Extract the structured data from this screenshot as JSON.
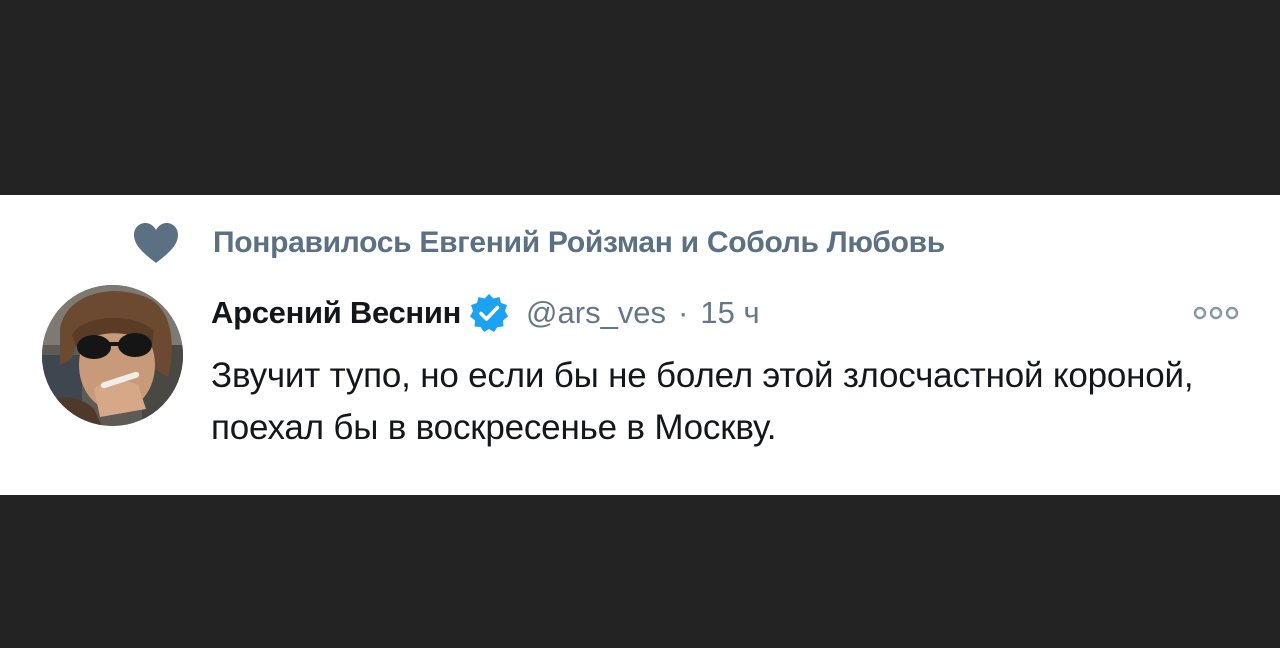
{
  "social_context": {
    "text": "Понравилось Евгений Ройзман и Соболь Любовь",
    "icon": "heart-icon"
  },
  "tweet": {
    "author_name": "Арсений Веснин",
    "verified_icon": "verified-badge-icon",
    "handle": "@ars_ves",
    "separator": "·",
    "time": "15 ч",
    "text": "Звучит тупо, но если бы не болел этой злосчастной короной, поехал бы в воскресенье в Москву.",
    "more_icon": "more-options-icon"
  },
  "colors": {
    "background": "#232323",
    "card": "#ffffff",
    "secondary_text": "#5b7083",
    "primary_text": "#14171a",
    "verified": "#1da1f2"
  }
}
